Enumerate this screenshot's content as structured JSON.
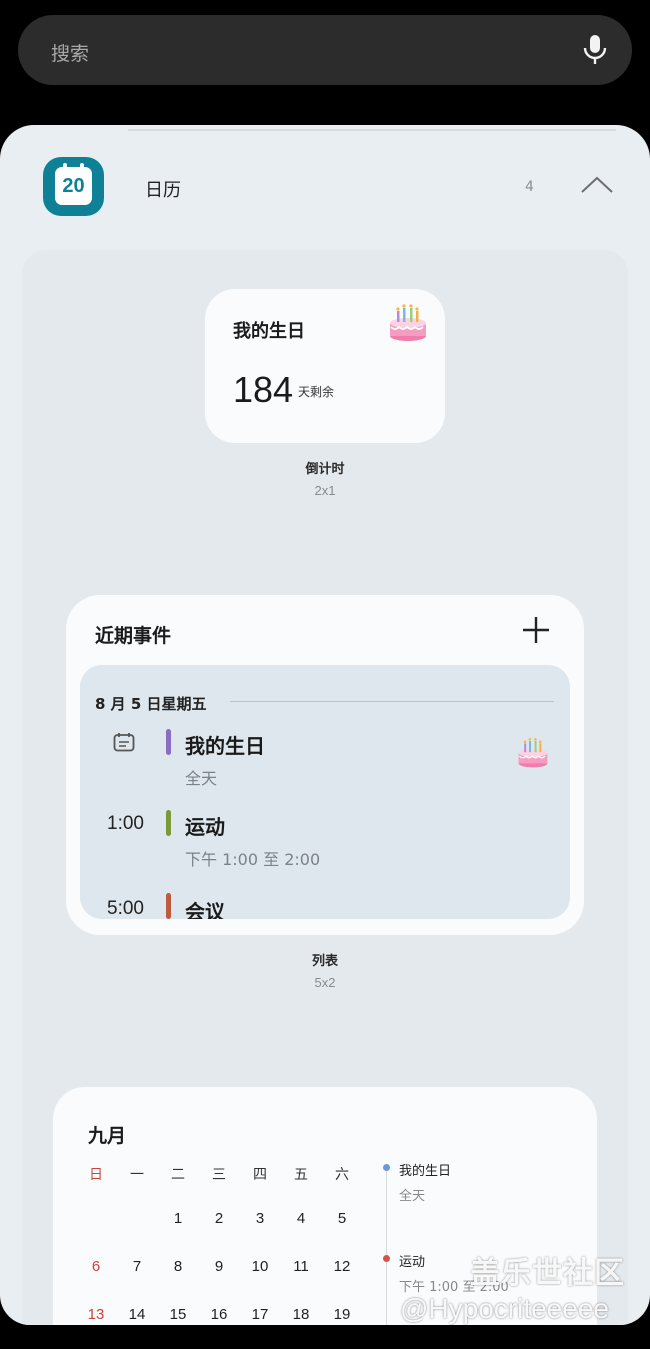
{
  "search": {
    "placeholder": "搜索"
  },
  "app": {
    "icon_day": "20",
    "name": "日历",
    "widget_count": "4"
  },
  "widgets": [
    {
      "type": "countdown",
      "title": "我的生日",
      "days": "184",
      "unit": "天剩余",
      "caption": "倒计时",
      "size": "2x1"
    },
    {
      "type": "list",
      "header": "近期事件",
      "date": "8 月 5 日星期五",
      "events": [
        {
          "time": "",
          "title": "我的生日",
          "sub": "全天",
          "color": "#8a6cc0"
        },
        {
          "time": "1:00",
          "title": "运动",
          "sub": "下午 1:00 至 2:00",
          "color": "#7a9a3a"
        },
        {
          "time": "5:00",
          "title": "会议",
          "sub": "",
          "color": "#c05a3c"
        }
      ],
      "caption": "列表",
      "size": "5x2"
    },
    {
      "type": "month",
      "title": "九月",
      "weekdays": [
        "日",
        "一",
        "二",
        "三",
        "四",
        "五",
        "六"
      ],
      "rows": [
        [
          "",
          "",
          "1",
          "2",
          "3",
          "4",
          "5"
        ],
        [
          "6",
          "7",
          "8",
          "9",
          "10",
          "11",
          "12"
        ],
        [
          "13",
          "14",
          "15",
          "16",
          "17",
          "18",
          "19"
        ]
      ],
      "agenda": [
        {
          "title": "我的生日",
          "sub": "全天",
          "color": "#6a9ad6"
        },
        {
          "title": "运动",
          "sub": "下午 1:00 至 2:00",
          "color": "#d0564a"
        }
      ]
    }
  ],
  "watermark": {
    "line1": "盖乐世社区",
    "line2": "@Hypocriteeeee"
  },
  "colors": {
    "accent": "#0e8197",
    "sunday": "#c8453a",
    "panel": "#e9eef3"
  }
}
